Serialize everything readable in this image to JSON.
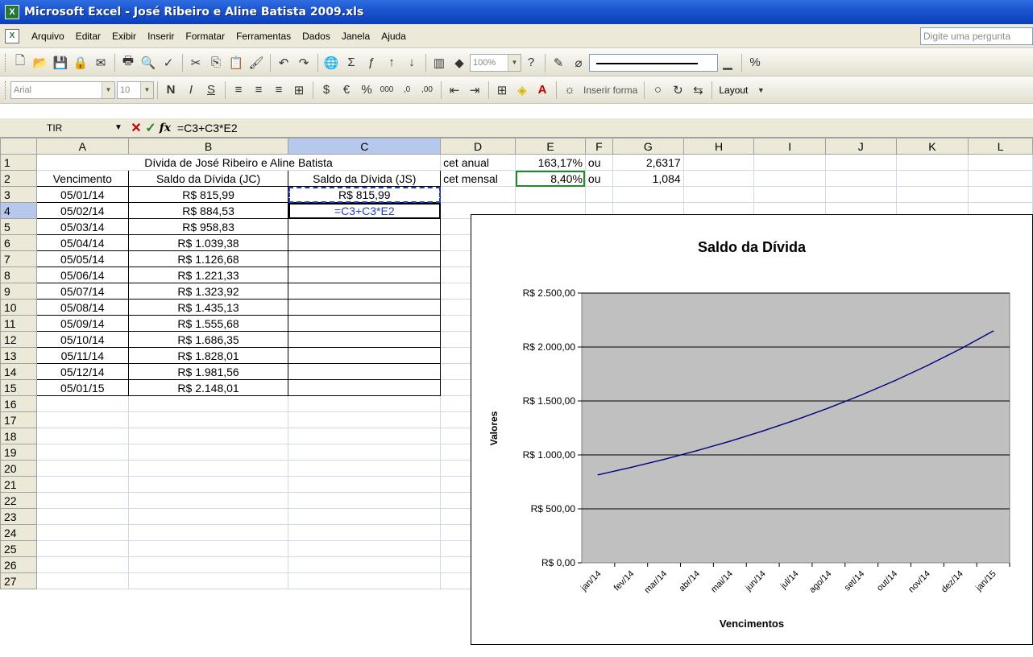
{
  "window": {
    "title": "Microsoft Excel - José Ribeiro e Aline Batista 2009.xls"
  },
  "menu": {
    "items": [
      "Arquivo",
      "Editar",
      "Exibir",
      "Inserir",
      "Formatar",
      "Ferramentas",
      "Dados",
      "Janela",
      "Ajuda"
    ],
    "ask_placeholder": "Digite uma pergunta"
  },
  "toolbar": {
    "zoom": "100%",
    "font_name": "Arial",
    "font_size": "10",
    "insert_shape": "Inserir forma",
    "layout": "Layout"
  },
  "formula_bar": {
    "name_box": "TIR",
    "formula": "=C3+C3*E2"
  },
  "columns": [
    "A",
    "B",
    "C",
    "D",
    "E",
    "F",
    "G",
    "H",
    "I",
    "J",
    "K",
    "L"
  ],
  "rows": [
    "1",
    "2",
    "3",
    "4",
    "5",
    "6",
    "7",
    "8",
    "9",
    "10",
    "11",
    "12",
    "13",
    "14",
    "15",
    "16",
    "17",
    "18",
    "19",
    "20",
    "21",
    "22",
    "23",
    "24",
    "25",
    "26",
    "27"
  ],
  "cells": {
    "title": "Dívida de José Ribeiro e Aline Batista",
    "d1": "cet anual",
    "e1": "163,17%",
    "f1": "ou",
    "g1": "2,6317",
    "d2": "cet mensal",
    "e2": "8,40%",
    "f2": "ou",
    "g2": "1,084",
    "headers": [
      "Vencimento",
      "Saldo da Dívida (JC)",
      "Saldo da Dívida (JS)"
    ],
    "c3": "R$ 815,99",
    "c4": "=C3+C3*E2",
    "data": [
      [
        "05/01/14",
        "R$ 815,99"
      ],
      [
        "05/02/14",
        "R$ 884,53"
      ],
      [
        "05/03/14",
        "R$ 958,83"
      ],
      [
        "05/04/14",
        "R$ 1.039,38"
      ],
      [
        "05/05/14",
        "R$ 1.126,68"
      ],
      [
        "05/06/14",
        "R$ 1.221,33"
      ],
      [
        "05/07/14",
        "R$ 1.323,92"
      ],
      [
        "05/08/14",
        "R$ 1.435,13"
      ],
      [
        "05/09/14",
        "R$ 1.555,68"
      ],
      [
        "05/10/14",
        "R$ 1.686,35"
      ],
      [
        "05/11/14",
        "R$ 1.828,01"
      ],
      [
        "05/12/14",
        "R$ 1.981,56"
      ],
      [
        "05/01/15",
        "R$ 2.148,01"
      ]
    ]
  },
  "colors": {
    "plot_area": "#c0c0c0",
    "series_line": "#000080",
    "selection": "#1f3fbf",
    "title_bar": "#0a3fb8"
  },
  "chart_data": {
    "type": "line",
    "title": "Saldo da Dívida",
    "xlabel": "Vencimentos",
    "ylabel": "Valores",
    "categories": [
      "jan/14",
      "fev/14",
      "mar/14",
      "abr/14",
      "mai/14",
      "jun/14",
      "jul/14",
      "ago/14",
      "set/14",
      "out/14",
      "nov/14",
      "dez/14",
      "jan/15"
    ],
    "series": [
      {
        "values": [
          815.99,
          884.53,
          958.83,
          1039.38,
          1126.68,
          1221.33,
          1323.92,
          1435.13,
          1555.68,
          1686.35,
          1828.01,
          1981.56,
          2148.01
        ]
      }
    ],
    "ylim": [
      0,
      2500
    ],
    "yticks": [
      0,
      500,
      1000,
      1500,
      2000,
      2500
    ],
    "ytick_labels": [
      "R$ 0,00",
      "R$ 500,00",
      "R$ 1.000,00",
      "R$ 1.500,00",
      "R$ 2.000,00",
      "R$ 2.500,00"
    ],
    "grid": true,
    "legend": "none"
  }
}
